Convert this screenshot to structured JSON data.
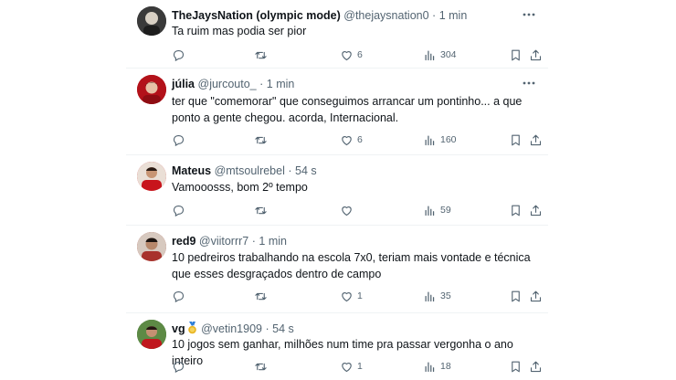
{
  "tweets": [
    {
      "name": "TheJaysNation (olympic mode)",
      "handle": "@thejaysnation0",
      "sep": "·",
      "time": "1 min",
      "text": "Ta ruim mas podia ser pior",
      "likes": "6",
      "views": "304",
      "avatar_color": "#3a3a3a"
    },
    {
      "name": "júlia",
      "handle": "@jurcouto_",
      "sep": "·",
      "time": "1 min",
      "text": "ter que \"comemorar\" que conseguimos arrancar um pontinho... a que ponto a gente chegou. acorda, Internacional.",
      "likes": "6",
      "views": "160",
      "avatar_color": "#b3121a"
    },
    {
      "name": "Mateus",
      "handle": "@mtsoulrebel",
      "sep": "·",
      "time": "54 s",
      "text": "Vamooosss, bom 2º tempo",
      "likes": "",
      "views": "59",
      "avatar_color": "#c8141c"
    },
    {
      "name": "red9",
      "handle": "@viitorrr7",
      "sep": "·",
      "time": "1 min",
      "text": "10 pedreiros trabalhando na escola 7x0, teriam mais vontade e técnica que esses desgraçados dentro de campo",
      "likes": "1",
      "views": "35",
      "avatar_color": "#a8322c"
    },
    {
      "name": "vg",
      "handle": "@vetin1909",
      "sep": "·",
      "time": "54 s",
      "text": "10 jogos sem ganhar, milhões num time pra passar vergonha o ano inteiro",
      "likes": "1",
      "views": "18",
      "avatar_color": "#2f6b2f",
      "badge": "medal-emoji"
    }
  ],
  "colors": {
    "text": "#0f1419",
    "meta": "#536471",
    "divider": "#eff3f4"
  }
}
